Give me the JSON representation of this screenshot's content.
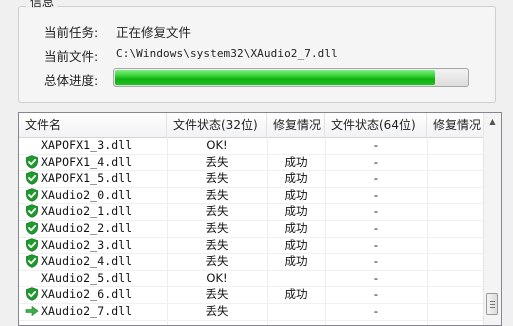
{
  "info": {
    "group_title": "信息",
    "task_label": "当前任务:",
    "task_value": "正在修复文件",
    "file_label": "当前文件:",
    "file_value": "C:\\Windows\\system32\\XAudio2_7.dll",
    "progress_label": "总体进度:",
    "progress_fraction": 0.91,
    "progress_color": "#22c022"
  },
  "table": {
    "headers": [
      "文件名",
      "文件状态(32位)",
      "修复情况",
      "文件状态(64位)",
      "修复情况"
    ],
    "rows": [
      {
        "icon": "none",
        "name": "XAPOFX1_3.dll",
        "status32": "OK!",
        "repair32": "",
        "status64": "-",
        "repair64": ""
      },
      {
        "icon": "shield-check",
        "name": "XAPOFX1_4.dll",
        "status32": "丢失",
        "repair32": "成功",
        "status64": "-",
        "repair64": ""
      },
      {
        "icon": "shield-check",
        "name": "XAPOFX1_5.dll",
        "status32": "丢失",
        "repair32": "成功",
        "status64": "-",
        "repair64": ""
      },
      {
        "icon": "shield-check",
        "name": "XAudio2_0.dll",
        "status32": "丢失",
        "repair32": "成功",
        "status64": "-",
        "repair64": ""
      },
      {
        "icon": "shield-check",
        "name": "XAudio2_1.dll",
        "status32": "丢失",
        "repair32": "成功",
        "status64": "-",
        "repair64": ""
      },
      {
        "icon": "shield-check",
        "name": "XAudio2_2.dll",
        "status32": "丢失",
        "repair32": "成功",
        "status64": "-",
        "repair64": ""
      },
      {
        "icon": "shield-check",
        "name": "XAudio2_3.dll",
        "status32": "丢失",
        "repair32": "成功",
        "status64": "-",
        "repair64": ""
      },
      {
        "icon": "shield-check",
        "name": "XAudio2_4.dll",
        "status32": "丢失",
        "repair32": "成功",
        "status64": "-",
        "repair64": ""
      },
      {
        "icon": "none",
        "name": "XAudio2_5.dll",
        "status32": "OK!",
        "repair32": "",
        "status64": "-",
        "repair64": ""
      },
      {
        "icon": "shield-check",
        "name": "XAudio2_6.dll",
        "status32": "丢失",
        "repair32": "成功",
        "status64": "-",
        "repair64": ""
      },
      {
        "icon": "arrow-right",
        "name": "XAudio2_7.dll",
        "status32": "丢失",
        "repair32": "",
        "status64": "-",
        "repair64": ""
      }
    ]
  },
  "colors": {
    "shield_green": "#1e9a2e",
    "arrow_green": "#3cb04a"
  }
}
